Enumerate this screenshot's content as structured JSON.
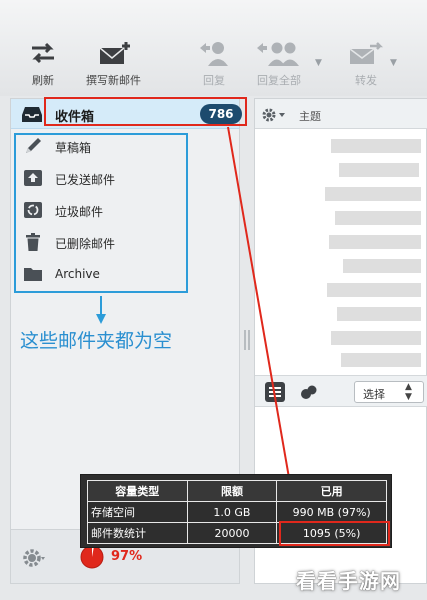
{
  "toolbar": {
    "refresh": "刷新",
    "compose": "撰写新邮件",
    "reply": "回复",
    "reply_all": "回复全部",
    "forward": "转发"
  },
  "folders": {
    "inbox": {
      "label": "收件箱",
      "count": "786"
    },
    "items": [
      {
        "label": "草稿箱",
        "icon": "pencil-icon"
      },
      {
        "label": "已发送邮件",
        "icon": "sent-tray-icon"
      },
      {
        "label": "垃圾邮件",
        "icon": "recycle-icon"
      },
      {
        "label": "已删除邮件",
        "icon": "trash-icon"
      },
      {
        "label": "Archive",
        "icon": "folder-icon"
      }
    ]
  },
  "annotation": {
    "empty_note": "这些邮件夹都为空"
  },
  "message_list": {
    "subject_header": "主题",
    "select_label": "选择"
  },
  "quota": {
    "headers": [
      "容量类型",
      "限额",
      "已用"
    ],
    "rows": [
      [
        "存储空间",
        "1.0 GB",
        "990 MB (97%)"
      ],
      [
        "邮件数统计",
        "20000",
        "1095 (5%)"
      ]
    ],
    "percent": "97%"
  },
  "watermark": "看看手游网",
  "colors": {
    "badge": "#1d4b6e",
    "highlight_red": "#e0281c",
    "highlight_blue": "#2c9cd9",
    "quota_icon": "#e0281c"
  }
}
